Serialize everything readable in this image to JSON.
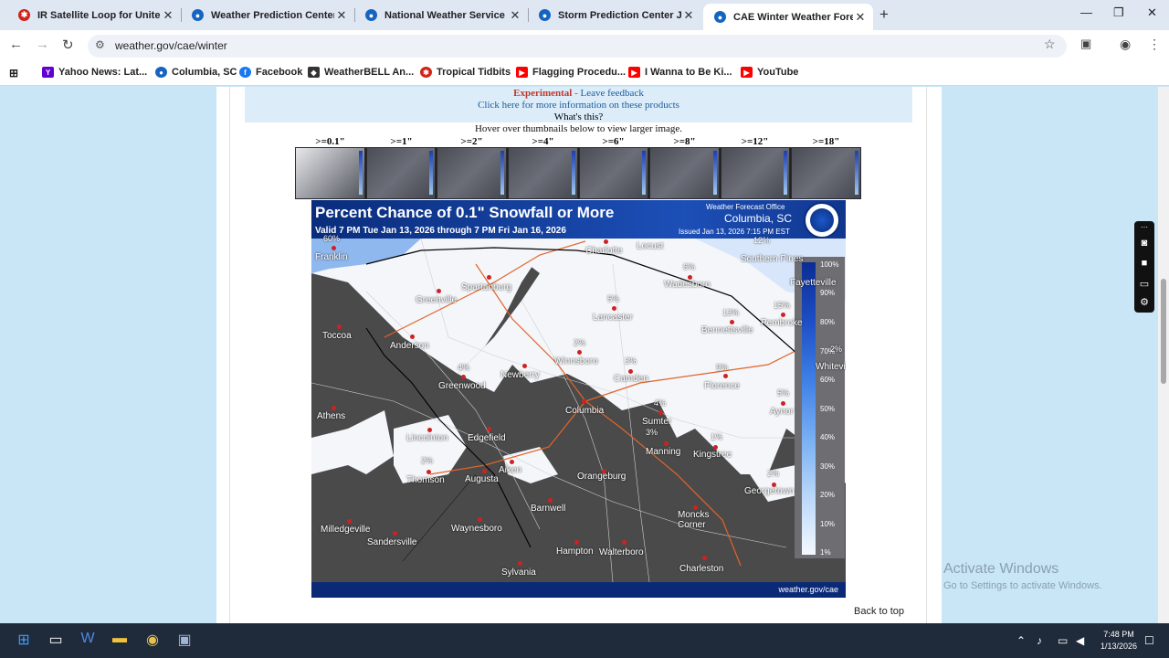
{
  "tabs": [
    {
      "label": "IR Satellite Loop for United",
      "icon": "hurricane-icon",
      "color": "#d0231a"
    },
    {
      "label": "Weather Prediction Center",
      "icon": "noaa-icon",
      "color": "#1565c0"
    },
    {
      "label": "National Weather Service",
      "icon": "noaa-icon",
      "color": "#1565c0"
    },
    {
      "label": "Storm Prediction Center Jan",
      "icon": "noaa-icon",
      "color": "#1565c0"
    },
    {
      "label": "CAE Winter Weather Foreca",
      "icon": "noaa-icon",
      "color": "#1565c0",
      "active": true
    }
  ],
  "newtab": "+",
  "url": "weather.gov/cae/winter",
  "bookmarks": [
    {
      "label": "Yahoo News: Lat...",
      "icon": "yahoo-icon",
      "color": "#6001d2"
    },
    {
      "label": "Columbia, SC",
      "icon": "noaa-icon",
      "color": "#1565c0"
    },
    {
      "label": "Facebook",
      "icon": "facebook-icon",
      "color": "#1877f2"
    },
    {
      "label": "WeatherBELL An...",
      "icon": "weatherbell-icon",
      "color": "#333333"
    },
    {
      "label": "Tropical Tidbits",
      "icon": "hurricane-icon",
      "color": "#d0231a"
    },
    {
      "label": "Flagging Procedu...",
      "icon": "youtube-icon",
      "color": "#ff0000"
    },
    {
      "label": "I Wanna to Be Ki...",
      "icon": "youtube-icon",
      "color": "#ff0000"
    },
    {
      "label": "YouTube",
      "icon": "youtube-icon",
      "color": "#ff0000"
    }
  ],
  "info": {
    "experimental": "Experimental",
    "dash": " - ",
    "feedback": "Leave feedback",
    "more": "Click here for more information on these products",
    "whats": "What's this?"
  },
  "hover_text": "Hover over thumbnails below to view larger image.",
  "thresholds": [
    ">=0.1\"",
    ">=1\"",
    ">=2\"",
    ">=4\"",
    ">=6\"",
    ">=8\"",
    ">=12\"",
    ">=18\""
  ],
  "map": {
    "title": "Percent Chance of 0.1\" Snowfall or More",
    "valid": "Valid 7 PM Tue Jan 13, 2026 through 7 PM Fri Jan 16, 2026",
    "wfo_label": "Weather Forecast Office",
    "wfo_city": "Columbia, SC",
    "issued": "Issued Jan 13, 2026 7:15 PM EST",
    "footer": "weather.gov/cae",
    "legend": [
      "100%",
      "90%",
      "80%",
      "70%",
      "60%",
      "50%",
      "40%",
      "30%",
      "20%",
      "10%",
      "1%"
    ],
    "cities": [
      "Charlotte",
      "Locust",
      "Franklin",
      "Spartanburg",
      "Greenville",
      "Southern Pines",
      "Wadesboro",
      "Fayetteville",
      "Toccoa",
      "Anderson",
      "Lancaster",
      "Pembroke",
      "Bennettsville",
      "Winnsboro",
      "Camden",
      "Newberry",
      "Greenwood",
      "Whiteville",
      "Florence",
      "Columbia",
      "Athens",
      "Sumter",
      "Aynor",
      "Lincolnton",
      "Edgefield",
      "Manning",
      "Kingstree",
      "Thomson",
      "Augusta",
      "Aiken",
      "Orangeburg",
      "Georgetown",
      "Barnwell",
      "Moncks Corner",
      "Milledgeville",
      "Waynesboro",
      "Sandersville",
      "Hampton",
      "Walterboro",
      "Sylvania",
      "Charleston"
    ],
    "percents": [
      "60%",
      "12%",
      "6%",
      "5%",
      "15%",
      "13%",
      "2%",
      "3%",
      "4%",
      "9%",
      "2%",
      "4%",
      "5%",
      "3%",
      "1%",
      "2%",
      "2%"
    ]
  },
  "back_to_top": "Back to top",
  "activate": {
    "line1": "Activate Windows",
    "line2": "Go to Settings to activate Windows."
  },
  "clock": {
    "time": "7:48 PM",
    "date": "1/13/2026"
  }
}
